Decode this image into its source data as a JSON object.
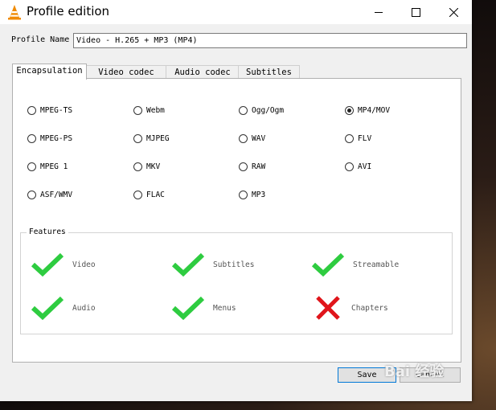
{
  "window": {
    "title": "Profile edition"
  },
  "profile": {
    "name_label": "Profile Name",
    "name_value": "Video - H.265 + MP3 (MP4)"
  },
  "tabs": [
    {
      "label": "Encapsulation",
      "active": true
    },
    {
      "label": "Video codec",
      "active": false
    },
    {
      "label": "Audio codec",
      "active": false
    },
    {
      "label": "Subtitles",
      "active": false
    }
  ],
  "encapsulation": {
    "options": [
      {
        "label": "MPEG-TS",
        "selected": false
      },
      {
        "label": "Webm",
        "selected": false
      },
      {
        "label": "Ogg/Ogm",
        "selected": false
      },
      {
        "label": "MP4/MOV",
        "selected": true
      },
      {
        "label": "MPEG-PS",
        "selected": false
      },
      {
        "label": "MJPEG",
        "selected": false
      },
      {
        "label": "WAV",
        "selected": false
      },
      {
        "label": "FLV",
        "selected": false
      },
      {
        "label": "MPEG 1",
        "selected": false
      },
      {
        "label": "MKV",
        "selected": false
      },
      {
        "label": "RAW",
        "selected": false
      },
      {
        "label": "AVI",
        "selected": false
      },
      {
        "label": "ASF/WMV",
        "selected": false
      },
      {
        "label": "FLAC",
        "selected": false
      },
      {
        "label": "MP3",
        "selected": false
      }
    ]
  },
  "features": {
    "title": "Features",
    "items": [
      {
        "label": "Video",
        "supported": true
      },
      {
        "label": "Subtitles",
        "supported": true
      },
      {
        "label": "Streamable",
        "supported": true
      },
      {
        "label": "Audio",
        "supported": true
      },
      {
        "label": "Menus",
        "supported": true
      },
      {
        "label": "Chapters",
        "supported": false
      }
    ]
  },
  "buttons": {
    "save": "Save",
    "cancel": "Cancel"
  },
  "colors": {
    "check": "#2ecc40",
    "cross": "#e0151b",
    "accent": "#0078d7"
  },
  "watermark": "Bai 经验"
}
